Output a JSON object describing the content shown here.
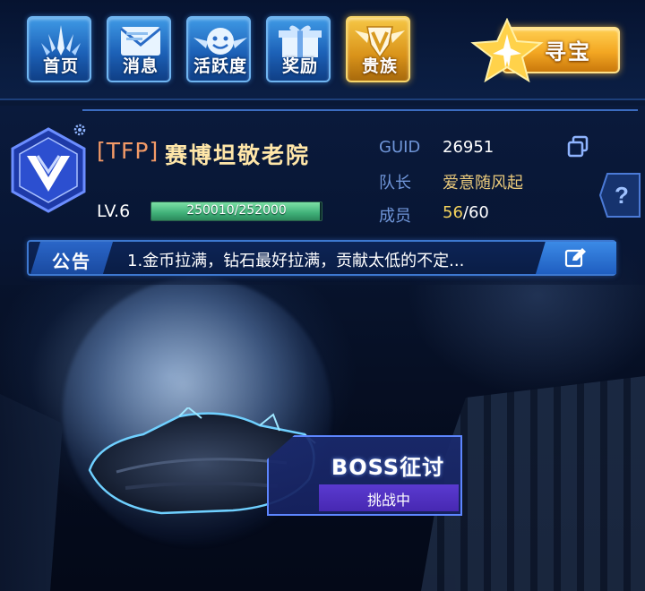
{
  "nav": {
    "items": [
      {
        "label": "首页",
        "icon": "home-spire-icon"
      },
      {
        "label": "消息",
        "icon": "mail-envelope-icon"
      },
      {
        "label": "活跃度",
        "icon": "smiley-wings-icon"
      },
      {
        "label": "奖励",
        "icon": "gift-box-icon"
      },
      {
        "label": "贵族",
        "icon": "noble-crest-icon"
      }
    ],
    "treasure": {
      "label": "寻宝",
      "icon": "star-jet-icon"
    }
  },
  "guild": {
    "tag": "[TFP]",
    "name": "赛博坦敬老院",
    "level": "LV.6",
    "exp_text": "250010/252000",
    "exp_fraction": 0.992,
    "info": {
      "guid_label": "GUID",
      "guid_value": "26951",
      "leader_label": "队长",
      "leader_value": "爱意随风起",
      "members_label": "成员",
      "members_current": "56",
      "members_max": "/60"
    }
  },
  "notice": {
    "tag": "公告",
    "text": "1.金币拉满，钻石最好拉满，贡献太低的不定..."
  },
  "boss": {
    "title": "BOSS征讨",
    "status": "挑战中"
  },
  "colors": {
    "nav_blue": "#1d62b8",
    "nav_gold": "#f6c745",
    "guild_name": "#ffe6a8",
    "guild_tag": "#f39a67",
    "info_label": "#6f95d8",
    "exp_green": "#3fb078",
    "boss_purple": "#4728b2"
  }
}
